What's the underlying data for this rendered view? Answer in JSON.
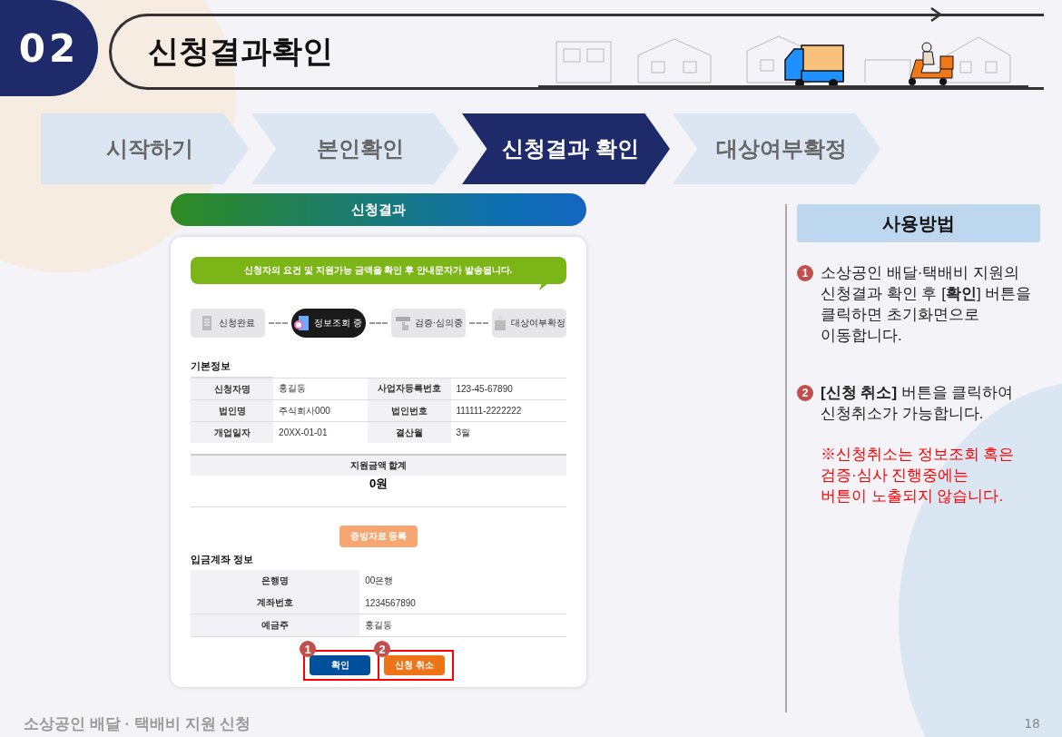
{
  "badge": {
    "number": "02"
  },
  "title": "신청결과확인",
  "steps": [
    {
      "label": "시작하기",
      "selected": false
    },
    {
      "label": "본인확인",
      "selected": false
    },
    {
      "label": "신청결과 확인",
      "selected": true
    },
    {
      "label": "대상여부확정",
      "selected": false
    }
  ],
  "result_panel": {
    "title": "신청결과",
    "notice": "신청자의 요건 및 지원가능 금액을 확인 후 안내문자가 발송됩니다.",
    "progress": [
      {
        "label": "신청완료",
        "selected": false
      },
      {
        "label": "정보조회 중",
        "selected": true
      },
      {
        "label": "검증·심의중",
        "selected": false
      },
      {
        "label": "대상여부확정",
        "selected": false
      }
    ],
    "basic_info": {
      "title": "기본정보",
      "rows": [
        [
          {
            "label": "신청자명",
            "value": "홍길동"
          },
          {
            "label": "사업자등록번호",
            "value": "123-45-67890"
          }
        ],
        [
          {
            "label": "법인명",
            "value": "주식회사000"
          },
          {
            "label": "법인번호",
            "value": "111111-2222222"
          }
        ],
        [
          {
            "label": "개업일자",
            "value": "20XX-01-01"
          },
          {
            "label": "결산월",
            "value": "3월"
          }
        ]
      ]
    },
    "total": {
      "label": "지원금액 합계",
      "value": "0원"
    },
    "evidence_button": "증빙자료 등록",
    "account": {
      "title": "입금계좌 정보",
      "rows": [
        {
          "label": "은행명",
          "value": "00은행"
        },
        {
          "label": "계좌번호",
          "value": "1234567890"
        },
        {
          "label": "예금주",
          "value": "홍길동"
        }
      ]
    },
    "buttons": [
      {
        "label": "확인",
        "marker": "1",
        "kind": "primary"
      },
      {
        "label": "신청 취소",
        "marker": "2",
        "kind": "cancel"
      }
    ]
  },
  "guide": {
    "title": "사용방법",
    "items": [
      {
        "marker": "1",
        "text": "소상공인 배달·택배비 지원의 신청결과 확인 후 [**확인**] 버튼을 클릭하면 초기화면으로 이동합니다."
      },
      {
        "marker": "2",
        "text": "**[신청 취소]** 버튼을 클릭하여 신청취소가 가능합니다.",
        "note": "※신청취소는 정보조회 혹은 검증·심사 진행중에는\n버튼이 노출되지 않습니다."
      }
    ]
  },
  "footer": {
    "title": "소상공인 배달 · 택배비 지원 신청",
    "page": "18"
  }
}
